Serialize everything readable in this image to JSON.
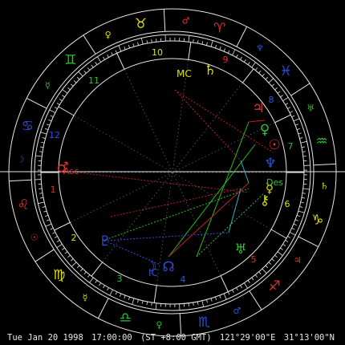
{
  "footer": {
    "date": "Tue Jan 20 1998",
    "time": "17:00:00",
    "zone": "(ST +8:00 GMT)",
    "longitude": "121°29'00\"E",
    "latitude": "31°13'00\"N"
  },
  "angles": {
    "asc_label": "Asc",
    "mc_label": "MC",
    "des_label": "Des",
    "ic_label": "IC"
  },
  "houses": [
    "1",
    "2",
    "3",
    "4",
    "5",
    "6",
    "7",
    "8",
    "9",
    "10",
    "11",
    "12"
  ],
  "signs": [
    {
      "glyph": "♈",
      "color": "#e03030",
      "ruler": "♂"
    },
    {
      "glyph": "♉",
      "color": "#e0e000",
      "ruler": "♀"
    },
    {
      "glyph": "♊",
      "color": "#30c030",
      "ruler": "☿"
    },
    {
      "glyph": "♋",
      "color": "#3050e0",
      "ruler": "☽"
    },
    {
      "glyph": "♌",
      "color": "#e03030",
      "ruler": "☉"
    },
    {
      "glyph": "♍",
      "color": "#e0e000",
      "ruler": "☿"
    },
    {
      "glyph": "♎",
      "color": "#30c030",
      "ruler": "♀"
    },
    {
      "glyph": "♏",
      "color": "#3050e0",
      "ruler": "♂"
    },
    {
      "glyph": "♐",
      "color": "#e03030",
      "ruler": "♃"
    },
    {
      "glyph": "♑",
      "color": "#e0e000",
      "ruler": "♄"
    },
    {
      "glyph": "♒",
      "color": "#30c030",
      "ruler": "♅"
    },
    {
      "glyph": "♓",
      "color": "#3050e0",
      "ruler": "♆"
    }
  ],
  "planets": [
    {
      "name": "Sun",
      "glyph": "☉",
      "color": "#e03030"
    },
    {
      "name": "Moon",
      "glyph": "☽",
      "color": "#3050e0"
    },
    {
      "name": "Mercury",
      "glyph": "☿",
      "color": "#e0e000"
    },
    {
      "name": "Venus",
      "glyph": "♀",
      "color": "#30c030"
    },
    {
      "name": "Mars",
      "glyph": "♂",
      "color": "#e03030"
    },
    {
      "name": "Jupiter",
      "glyph": "♃",
      "color": "#e03030"
    },
    {
      "name": "Saturn",
      "glyph": "♄",
      "color": "#e0e000"
    },
    {
      "name": "Uranus",
      "glyph": "♅",
      "color": "#30c030"
    },
    {
      "name": "Neptune",
      "glyph": "♆",
      "color": "#3050e0"
    },
    {
      "name": "Pluto",
      "glyph": "♇",
      "color": "#3050e0"
    },
    {
      "name": "Chiron",
      "glyph": "⚷",
      "color": "#e0e000"
    },
    {
      "name": "Node",
      "glyph": "☊",
      "color": "#3050e0"
    }
  ]
}
